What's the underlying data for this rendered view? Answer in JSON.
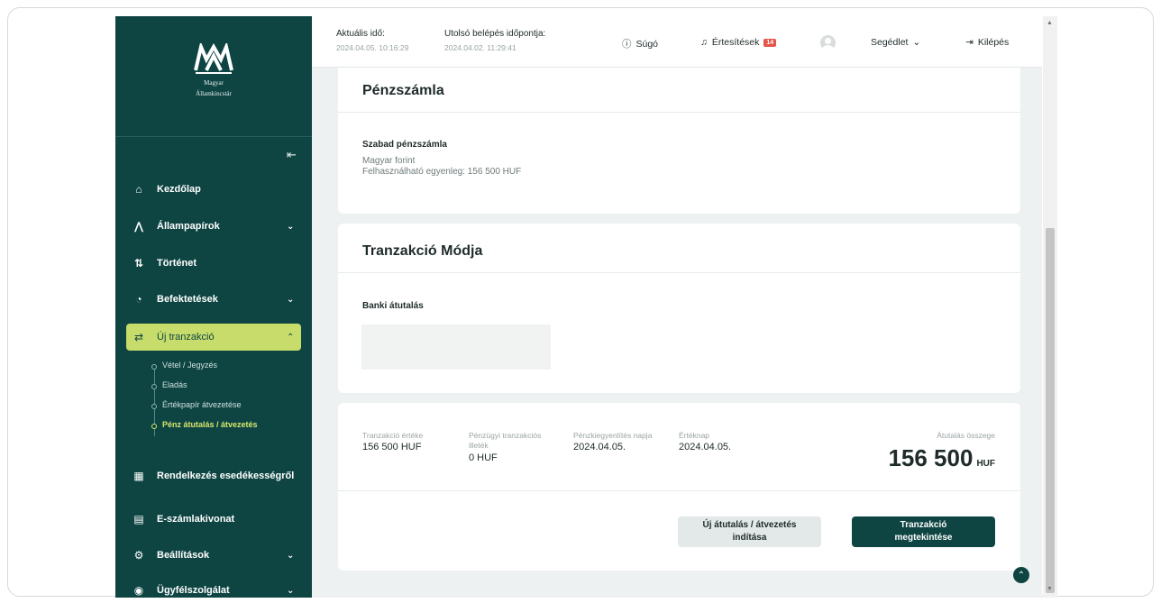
{
  "logo": {
    "line1": "Magyar",
    "line2": "Államkincstár"
  },
  "sidebar": {
    "items": [
      {
        "label": "Kezdőlap",
        "icon": "home-icon"
      },
      {
        "label": "Állampapírok",
        "icon": "chart-icon",
        "expandable": true
      },
      {
        "label": "Történet",
        "icon": "history-icon"
      },
      {
        "label": "Befektetések",
        "icon": "piggy-bank-icon",
        "expandable": true
      },
      {
        "label": "Új tranzakció",
        "icon": "transfer-icon",
        "expandable": true,
        "active": true
      },
      {
        "label": "Rendelkezés esedékességről",
        "icon": "calendar-icon"
      },
      {
        "label": "E-számlakivonat",
        "icon": "document-icon"
      },
      {
        "label": "Beállítások",
        "icon": "gear-icon",
        "expandable": true
      },
      {
        "label": "Ügyfélszolgálat",
        "icon": "support-icon",
        "expandable": true
      }
    ],
    "subitems": [
      {
        "label": "Vétel / Jegyzés"
      },
      {
        "label": "Eladás"
      },
      {
        "label": "Értékpapír átvezetése"
      },
      {
        "label": "Pénz átutalás / átvezetés",
        "current": true
      }
    ]
  },
  "header": {
    "current_time_label": "Aktuális idő:",
    "current_time_value": "2024.04.05. 10:16:29",
    "last_login_label": "Utolsó belépés időpontja:",
    "last_login_value": "2024.04.02. 11:29:41",
    "help": "Súgó",
    "notifications": "Értesítések",
    "notifications_count": "14",
    "guide": "Segédlet",
    "logout": "Kilépés"
  },
  "account_card": {
    "title": "Pénzszámla",
    "account_name": "Szabad pénzszámla",
    "currency": "Magyar forint",
    "balance": "Felhasználható egyenleg: 156 500 HUF"
  },
  "mode_card": {
    "title": "Tranzakció Módja",
    "method": "Banki átutalás"
  },
  "summary": {
    "value_label": "Tranzakció értéke",
    "value": "156 500 HUF",
    "fee_label_1": "Pénzügyi tranzakciós",
    "fee_label_2": "illeték",
    "fee": "0 HUF",
    "settle_label": "Pénzkiegyenlítés napja",
    "settle_date": "2024.04.05.",
    "value_date_label": "Értéknap",
    "value_date": "2024.04.05.",
    "amount_label": "Átutalás összege",
    "amount": "156 500",
    "amount_currency": "HUF",
    "new_transfer_line1": "Új átutalás / átvezetés",
    "new_transfer_line2": "indítása",
    "review_line1": "Tranzakció",
    "review_line2": "megtekintése"
  },
  "colors": {
    "sidebar_bg": "#0e4543",
    "active_item": "#c7dc6b",
    "badge": "#e4554a",
    "main_bg": "#eef1f1"
  }
}
